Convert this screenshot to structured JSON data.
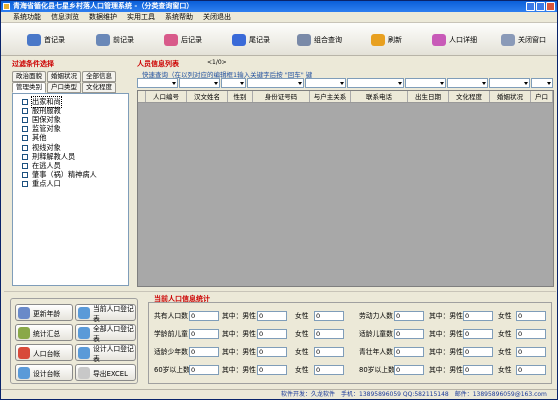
{
  "window": {
    "title": "青海省循化县七星乡村落人口管理系统 -（分类查询窗口）"
  },
  "menu": [
    "系统功能",
    "信息浏览",
    "数据维护",
    "实用工具",
    "系统帮助",
    "关闭退出"
  ],
  "toolbar": [
    {
      "label": "首记录",
      "icon": "first-record-icon",
      "color": "#4a78c8"
    },
    {
      "label": "前记录",
      "icon": "prev-record-icon",
      "color": "#6a88b8"
    },
    {
      "label": "后记录",
      "icon": "next-record-icon",
      "color": "#d85a8a"
    },
    {
      "label": "尾记录",
      "icon": "last-record-icon",
      "color": "#3a6ad8"
    },
    {
      "label": "组合查询",
      "icon": "combined-query-icon",
      "color": "#7a8aa8"
    },
    {
      "label": "刷新",
      "icon": "refresh-icon",
      "color": "#e8a020"
    },
    {
      "label": "人口详细",
      "icon": "population-detail-icon",
      "color": "#c85ab8"
    },
    {
      "label": "关闭窗口",
      "icon": "close-window-icon",
      "color": "#8a9ab8"
    }
  ],
  "filter": {
    "title": "过滤条件选择",
    "tabs_row1": [
      "政治面貌",
      "婚姻状况",
      "全部信息"
    ],
    "tabs_row2": [
      "管理类别",
      "户口类型",
      "文化程度"
    ],
    "active_tab": "管理类别",
    "items": [
      "出家和尚",
      "服刑服教",
      "国保对象",
      "监管对象",
      "其他",
      "视线对象",
      "刑释解教人员",
      "在逃人员",
      "肇事（祸）精神病人",
      "重点人口"
    ]
  },
  "list": {
    "title": "人员信息列表",
    "count": "<1/0>",
    "hint": "快速查询（在以列对应的编辑框1输入关键字后按 \"回车\" 键",
    "columns": [
      "人口编号",
      "汉文姓名",
      "性别",
      "身份证号码",
      "与户主关系",
      "联系电话",
      "出生日期",
      "文化程度",
      "婚姻状况",
      "户口"
    ]
  },
  "actions": [
    {
      "label": "更新年龄",
      "icon": "update-age-icon",
      "color": "#6a8ac8"
    },
    {
      "label": "当前人口登记表",
      "icon": "current-register-icon",
      "color": "#5a9ad8"
    },
    {
      "label": "统计汇总",
      "icon": "statistics-icon",
      "color": "#8aa848"
    },
    {
      "label": "全部人口登记表",
      "icon": "all-register-icon",
      "color": "#5a9ad8"
    },
    {
      "label": "人口台帐",
      "icon": "population-ledger-icon",
      "color": "#d84a3a"
    },
    {
      "label": "设计人口登记表",
      "icon": "design-register-icon",
      "color": "#5a9ad8"
    },
    {
      "label": "设计台帐",
      "icon": "design-ledger-icon",
      "color": "#5a9ad8"
    },
    {
      "label": "导出EXCEL",
      "icon": "export-excel-icon",
      "color": "#c8c8c8"
    }
  ],
  "stats": {
    "title": "当前人口信息统计",
    "rows": [
      {
        "label": "共有人口数",
        "total": "0",
        "male": "0",
        "female": "0",
        "label2": "劳动力人数",
        "total2": "0",
        "male2": "0",
        "female2": "0"
      },
      {
        "label": "学龄前儿童",
        "total": "0",
        "male": "0",
        "female": "0",
        "label2": "适龄儿童数",
        "total2": "0",
        "male2": "0",
        "female2": "0"
      },
      {
        "label": "适龄少年数",
        "total": "0",
        "male": "0",
        "female": "0",
        "label2": "青壮年人数",
        "total2": "0",
        "male2": "0",
        "female2": "0"
      },
      {
        "label": "60岁以上数",
        "total": "0",
        "male": "0",
        "female": "0",
        "label2": "80岁以上数",
        "total2": "0",
        "male2": "0",
        "female2": "0"
      }
    ],
    "among": "其中：男性",
    "female_label": "女性"
  },
  "statusbar": {
    "text": "软件开发：久龙软件　手机：13895896059  QQ:582115148　邮件：13895896059@163.com"
  }
}
